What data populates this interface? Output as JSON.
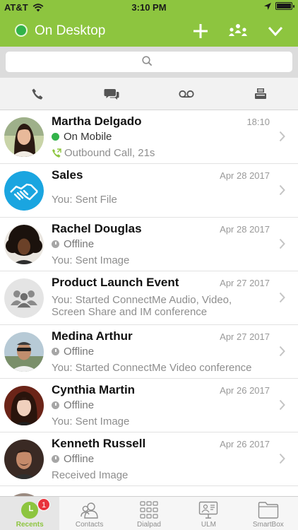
{
  "status_bar": {
    "carrier": "AT&T",
    "time": "3:10 PM"
  },
  "header": {
    "title": "On Desktop",
    "accent": "#8dc53f",
    "presence_color": "#32b34a"
  },
  "search": {
    "placeholder": ""
  },
  "filters": [
    {
      "icon": "phone-icon"
    },
    {
      "icon": "chat-icon"
    },
    {
      "icon": "voicemail-icon"
    },
    {
      "icon": "fax-icon"
    }
  ],
  "recents": [
    {
      "name": "Martha Delgado",
      "date": "18:10",
      "status": "On Mobile",
      "status_color": "#32b34a",
      "detail": "Outbound Call, 21s",
      "avatar": "photo"
    },
    {
      "name": "Sales",
      "date": "Apr 28 2017",
      "detail": "You: Sent File",
      "avatar": "handshake"
    },
    {
      "name": "Rachel Douglas",
      "date": "Apr 28 2017",
      "status": "Offline",
      "detail": "You: Sent Image",
      "avatar": "photo"
    },
    {
      "name": "Product Launch Event",
      "date": "Apr 27 2017",
      "detail_line1": "You: Started ConnectMe Audio, Video,",
      "detail_line2": "Screen Share and IM conference",
      "avatar": "group"
    },
    {
      "name": "Medina Arthur",
      "date": "Apr 27 2017",
      "status": "Offline",
      "detail": "You: Started ConnectMe Video conference",
      "avatar": "photo"
    },
    {
      "name": "Cynthia Martin",
      "date": "Apr 26 2017",
      "status": "Offline",
      "detail": "You: Sent Image",
      "avatar": "photo"
    },
    {
      "name": "Kenneth Russell",
      "date": "Apr 26 2017",
      "status": "Offline",
      "detail": "Received Image",
      "avatar": "photo"
    }
  ],
  "tabbar": {
    "recents_label": "Recents",
    "recents_badge": "1",
    "contacts_label": "Contacts",
    "dialpad_label": "Dialpad",
    "ulm_label": "ULM",
    "smartbox_label": "SmartBox"
  }
}
